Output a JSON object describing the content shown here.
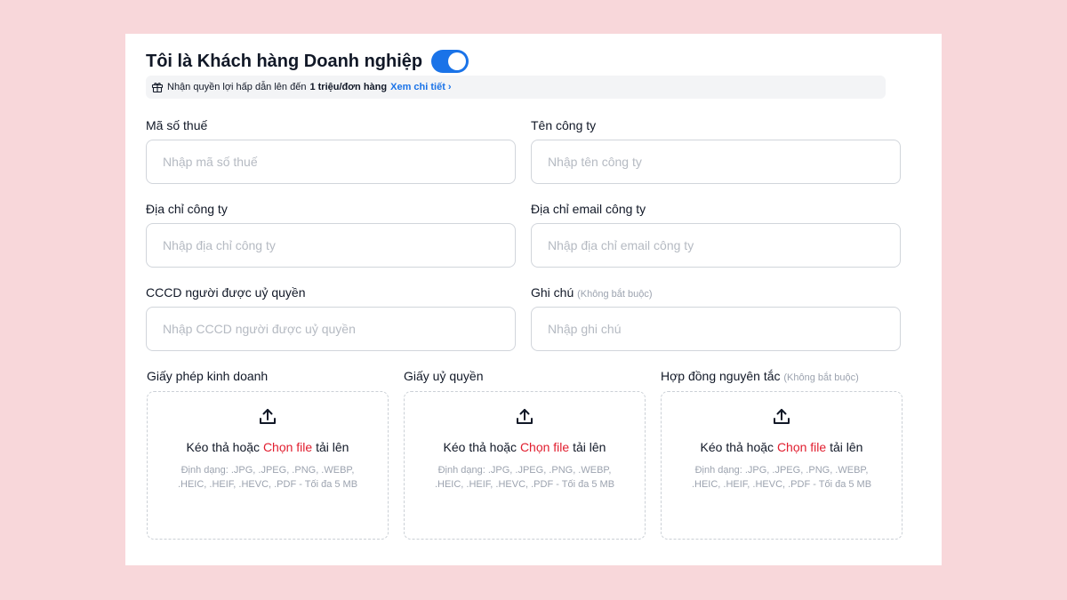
{
  "header": {
    "title": "Tôi là Khách hàng Doanh nghiệp",
    "toggle_on": true
  },
  "benefit": {
    "icon": "gift-icon",
    "text": "Nhận quyền lợi hấp dẫn lên đến",
    "highlight": "1 triệu/đơn hàng",
    "link": "Xem chi tiết ›"
  },
  "fields": {
    "tax_code": {
      "label": "Mã số thuế",
      "placeholder": "Nhập mã số thuế",
      "value": ""
    },
    "company_name": {
      "label": "Tên công ty",
      "placeholder": "Nhập tên công ty",
      "value": ""
    },
    "company_address": {
      "label": "Địa chỉ công ty",
      "placeholder": "Nhập địa chỉ công ty",
      "value": ""
    },
    "company_email": {
      "label": "Địa chỉ email công ty",
      "placeholder": "Nhập địa chỉ email công ty",
      "value": ""
    },
    "authorized_id": {
      "label": "CCCD người được uỷ quyền",
      "placeholder": "Nhập CCCD người được uỷ quyền",
      "value": ""
    },
    "note": {
      "label": "Ghi chú",
      "optional": "(Không bắt buộc)",
      "placeholder": "Nhập ghi chú",
      "value": ""
    }
  },
  "uploads": {
    "common": {
      "drag_prefix": "Kéo thả hoặc",
      "choose": "Chọn file",
      "drag_suffix": "tải lên",
      "formats": "Định dạng: .JPG, .JPEG, .PNG, .WEBP, .HEIC, .HEIF, .HEVC, .PDF - Tối đa 5 MB",
      "icon": "upload-icon"
    },
    "business_license": {
      "label": "Giấy phép kinh doanh"
    },
    "authorization": {
      "label": "Giấy uỷ quyền"
    },
    "framework_contract": {
      "label": "Hợp đồng nguyên tắc",
      "optional": "(Không bắt buộc)"
    }
  },
  "colors": {
    "accent": "#1a73e8",
    "choose_file": "#e11d2e",
    "background": "#f8d7da"
  }
}
